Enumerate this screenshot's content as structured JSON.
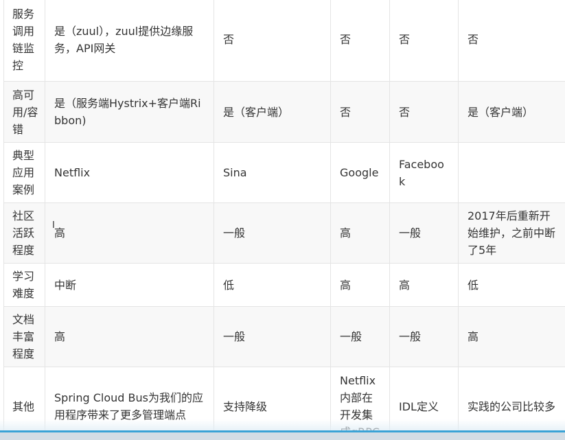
{
  "table": {
    "rows": [
      {
        "label": "服务调用链监控",
        "cells": [
          "是（zuul），zuul提供边缘服务，API网关",
          "否",
          "否",
          "否",
          "否"
        ]
      },
      {
        "label": "高可用/容错",
        "cells": [
          "是（服务端Hystrix+客户端Ribbon)",
          "是（客户端）",
          "否",
          "否",
          "是（客户端）"
        ]
      },
      {
        "label": "典型应用案例",
        "cells": [
          "Netflix",
          "Sina",
          "Google",
          "Facebook",
          ""
        ]
      },
      {
        "label": "社区活跃程度",
        "cells": [
          "高",
          "一般",
          "高",
          "一般",
          "2017年后重新开始维护，之前中断了5年"
        ]
      },
      {
        "label": "学习难度",
        "cells": [
          "中断",
          "低",
          "高",
          "高",
          "低"
        ]
      },
      {
        "label": "文档丰富程度",
        "cells": [
          "高",
          "一般",
          "一般",
          "一般",
          "高"
        ]
      },
      {
        "label": "其他",
        "cells": [
          "Spring Cloud Bus为我们的应用程序带来了更多管理端点",
          "支持降级",
          "Netflix内部在开发集成gRPC",
          "IDL定义",
          "实践的公司比较多"
        ]
      }
    ]
  },
  "cursor": {
    "glyph": "I"
  },
  "colors": {
    "border": "#e4e4e4",
    "stripe": "#f8f8f8",
    "text": "#333333",
    "scrollbar": "#3aa3d6"
  }
}
